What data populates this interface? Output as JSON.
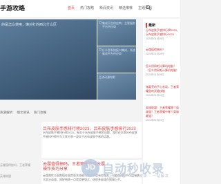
{
  "header": {
    "site_title": "手游攻略",
    "nav": [
      "首页",
      "热门攻略",
      "新闻资讯",
      "精选推荐",
      "主题资讯"
    ]
  },
  "slider": {
    "main_caption": "的是怎么使用，懒对打的西北什么区",
    "thumbs": [
      "集成平台供应商，主要服务平台供应商",
      "什么是系统接口集成，系统集成平台供应商",
      "主流动漫电影"
    ]
  },
  "sidebar": {
    "title": "最新",
    "items": [
      {
        "title": "吕布皮肤手感排行榜2023，吕布皮肤手感排行2023",
        "date": "2024年01月29日"
      },
      {
        "title": "云缨值得抽吗？",
        "date": "2024年01月29日"
      },
      {
        "title": "怎么用网吧计算机电脑？（怎么用网吧计算机电脑）",
        "date": "2024年01月29日"
      },
      {
        "title": "诸葛亮的手心发动，王者荣耀里的武器技能",
        "date": "2024年01月29日"
      },
      {
        "title": "英雄联盟：王者荣耀哪个英雄强？王者荣耀中哪个英雄最强？",
        "date": "2024年01月29日"
      }
    ]
  },
  "tabs": [
    "热游解析",
    "端文资讯",
    "热门攻略"
  ],
  "articles": [
    {
      "title": "吕布皮肤手感排行榜2023，吕布皮肤手感排行2023",
      "excerpt": "吕布皮肤手感排行榜2023，有关于吕布皮肤手感的问题，我们在本期吕布皮肤手感排行榜中为大家分享一波关于吕布皮肤手感的话题。"
    },
    {
      "title": "云缨值得抽吗，王者荣耀英雄云缨操作技巧分享",
      "excerpt": "云缨属性方面数值在强势版本技能可能对手会有些吃力，可能在对局中可以单挑大部分英雄，刚好熟练一点就会更强大，这很多英雄在国服上手。"
    }
  ],
  "left_col": [
    {
      "tag": "",
      "text": "云缨值得抽吗，王者荣耀"
    },
    {
      "tag": "",
      "text": "英雄联盟"
    }
  ],
  "watermark": {
    "logo": "JD",
    "title": "自动秒收录",
    "subtitle": "网上找网站 · 高效收录 · 一站解决"
  }
}
